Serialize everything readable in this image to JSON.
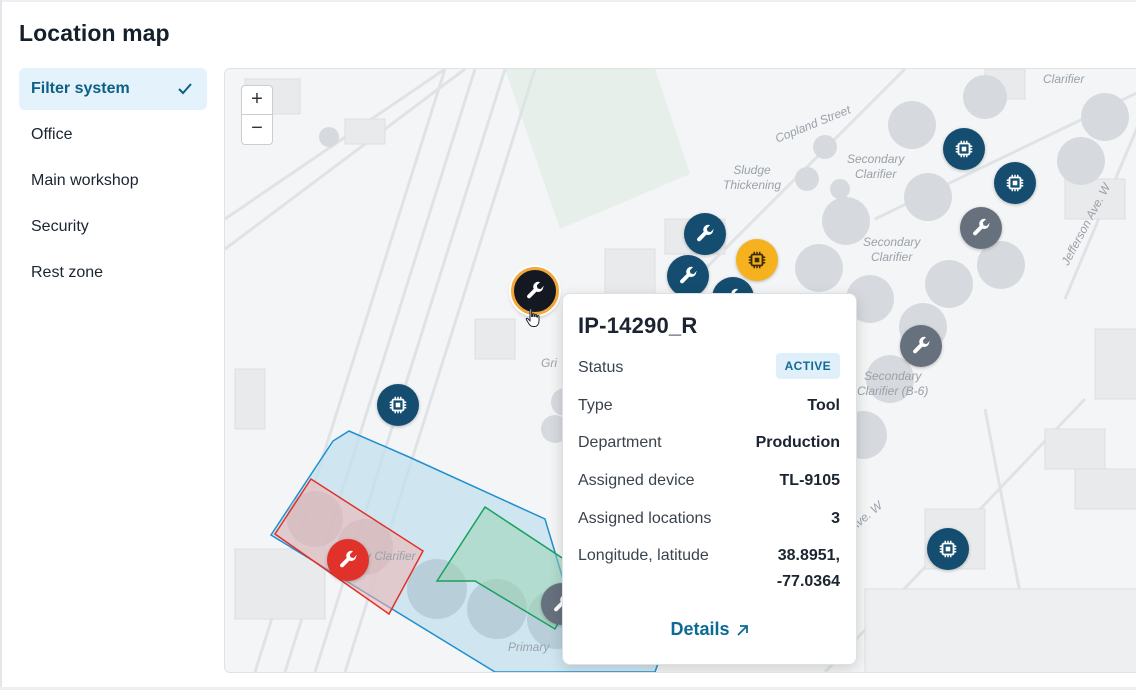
{
  "page": {
    "title": "Location map"
  },
  "sidebar": {
    "items": [
      {
        "label": "Filter system",
        "active": true
      },
      {
        "label": "Office"
      },
      {
        "label": "Main workshop"
      },
      {
        "label": "Security"
      },
      {
        "label": "Rest zone"
      }
    ]
  },
  "map": {
    "zoom_in": "+",
    "zoom_out": "−",
    "labels": {
      "clarifier_top": "Clarifier",
      "copland": "Copland Street",
      "sludge": "Sludge\nThickening",
      "secondary_1": "Secondary\nClarifier",
      "secondary_2": "Secondary\nClarifier",
      "secondary_b6": "Secondary\nClarifier (B-6)",
      "jefferson": "Jefferson Ave. W",
      "ave_w": "Ave. W",
      "primary": "Primary",
      "y_clarifier": "y Clarifier",
      "gri": "Gri"
    },
    "marker_colors": {
      "navy": "#144d70",
      "grey": "#67717d",
      "yellow": "#f5b21e",
      "red": "#e0322b",
      "selected": "#141820",
      "selected_ring": "#f3a83a"
    }
  },
  "popup": {
    "title": "IP-14290_R",
    "status_label": "Status",
    "status_value": "ACTIVE",
    "type_label": "Type",
    "type_value": "Tool",
    "department_label": "Department",
    "department_value": "Production",
    "device_label": "Assigned device",
    "device_value": "TL-9105",
    "locations_label": "Assigned locations",
    "locations_value": "3",
    "coords_label": "Longitude, latitude",
    "coords_value_1": "38.8951,",
    "coords_value_2": "-77.0364",
    "details_label": "Details"
  }
}
